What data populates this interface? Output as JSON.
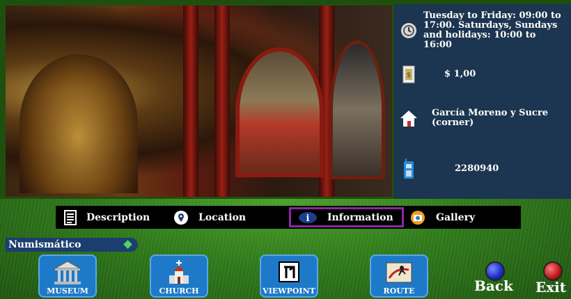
{
  "info": {
    "hours": "Tuesday to Friday: 09:00 to 17:00. Saturdays, Sundays and holidays: 10:00 to 16:00",
    "price": "$ 1,00",
    "address": "García Moreno y Sucre (corner)",
    "phone": "2280940"
  },
  "tabs": [
    {
      "label": "Description",
      "icon": "document-icon"
    },
    {
      "label": "Location",
      "icon": "map-pin-icon"
    },
    {
      "label": "Information",
      "icon": "info-icon",
      "active": true
    },
    {
      "label": "Gallery",
      "icon": "camera-icon"
    }
  ],
  "breadcrumb": "Numismático",
  "nav": {
    "museum": "MUSEUM",
    "church": "CHURCH",
    "viewpoint": "VIEWPOINT",
    "route": "ROUTE",
    "back": "Back",
    "exit": "Exit"
  },
  "colors": {
    "info_panel": "#1c3550",
    "active_tab_border": "#8a2aa0",
    "nav_button": "#1e7ac8",
    "back_circle": "#1a2cc8",
    "exit_circle": "#b81818"
  }
}
